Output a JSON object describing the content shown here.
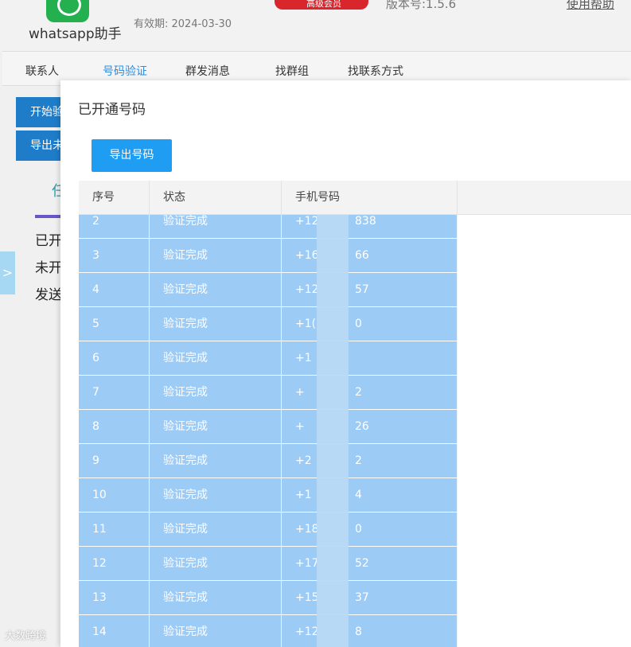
{
  "header": {
    "app_name": "whatsapp助手",
    "validity": "有效期: 2024-03-30",
    "vip_label": "高级会员",
    "version": "版本号:1.5.6",
    "help_link": "使用帮助"
  },
  "nav": {
    "items": [
      {
        "label": "联系人"
      },
      {
        "label": "号码验证"
      },
      {
        "label": "群发消息"
      },
      {
        "label": "找群组"
      },
      {
        "label": "找联系方式"
      }
    ]
  },
  "left_panel": {
    "start_btn": "开始验",
    "export_btn": "导出未",
    "tab_label": "任",
    "opened_text": "已开",
    "unopened_text": "未开",
    "send_text": "发送"
  },
  "modal": {
    "title": "已开通号码",
    "export_button": "导出号码",
    "columns": {
      "seq": "序号",
      "status": "状态",
      "phone": "手机号码"
    },
    "rows": [
      {
        "seq": "2",
        "status": "验证完成",
        "phone_prefix": "+12",
        "phone_suffix": "838"
      },
      {
        "seq": "3",
        "status": "验证完成",
        "phone_prefix": "+16",
        "phone_suffix": "66"
      },
      {
        "seq": "4",
        "status": "验证完成",
        "phone_prefix": "+12",
        "phone_suffix": "57"
      },
      {
        "seq": "5",
        "status": "验证完成",
        "phone_prefix": "+1(",
        "phone_suffix": "0"
      },
      {
        "seq": "6",
        "status": "验证完成",
        "phone_prefix": "+1",
        "phone_suffix": ""
      },
      {
        "seq": "7",
        "status": "验证完成",
        "phone_prefix": "+",
        "phone_suffix": "2"
      },
      {
        "seq": "8",
        "status": "验证完成",
        "phone_prefix": "+",
        "phone_suffix": "26"
      },
      {
        "seq": "9",
        "status": "验证完成",
        "phone_prefix": "+2",
        "phone_suffix": "2"
      },
      {
        "seq": "10",
        "status": "验证完成",
        "phone_prefix": "+1",
        "phone_suffix": "4"
      },
      {
        "seq": "11",
        "status": "验证完成",
        "phone_prefix": "+18",
        "phone_suffix": "0"
      },
      {
        "seq": "12",
        "status": "验证完成",
        "phone_prefix": "+17",
        "phone_suffix": "52"
      },
      {
        "seq": "13",
        "status": "验证完成",
        "phone_prefix": "+15",
        "phone_suffix": "37"
      },
      {
        "seq": "14",
        "status": "验证完成",
        "phone_prefix": "+12",
        "phone_suffix": "8"
      }
    ]
  },
  "watermark": "大数跨境",
  "colors": {
    "accent": "#1e9df3",
    "row_bg": "#9ccbf6",
    "vip": "#d9252c",
    "nav_active": "#2a8de0"
  }
}
